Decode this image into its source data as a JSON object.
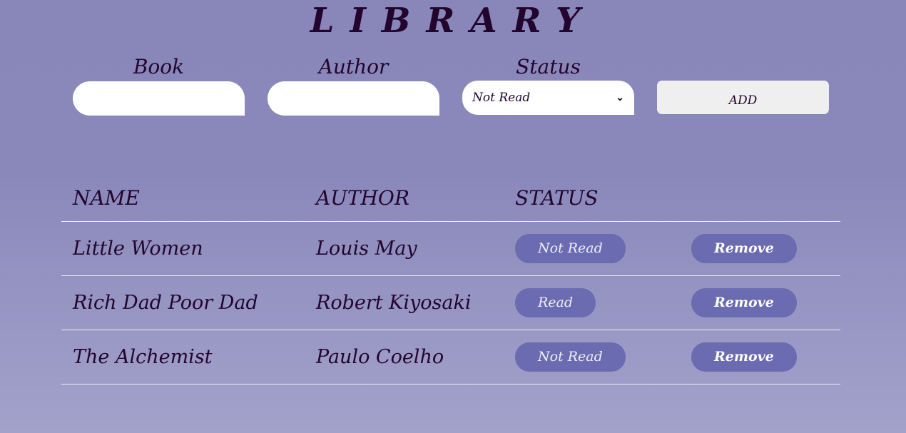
{
  "app": {
    "title": "LIBRARY"
  },
  "form": {
    "book_label": "Book",
    "author_label": "Author",
    "status_label": "Status",
    "book_value": "",
    "author_value": "",
    "status_selected": "Not Read",
    "add_label": "ADD"
  },
  "table": {
    "headers": [
      "NAME",
      "AUTHOR",
      "STATUS",
      ""
    ],
    "rows": [
      {
        "name": "Little Women",
        "author": "Louis May",
        "status": "Not Read",
        "action": "Remove"
      },
      {
        "name": "Rich Dad Poor Dad",
        "author": "Robert Kiyosaki",
        "status": "Read",
        "action": "Remove"
      },
      {
        "name": "The Alchemist",
        "author": "Paulo Coelho",
        "status": "Not Read",
        "action": "Remove"
      }
    ]
  },
  "colors": {
    "background_top": "#8987b9",
    "background_bottom": "#a3a2cb",
    "text": "#23052e",
    "pill": "#6b6bb2"
  },
  "icons": {
    "select_chevron": "chevron-down-icon"
  }
}
